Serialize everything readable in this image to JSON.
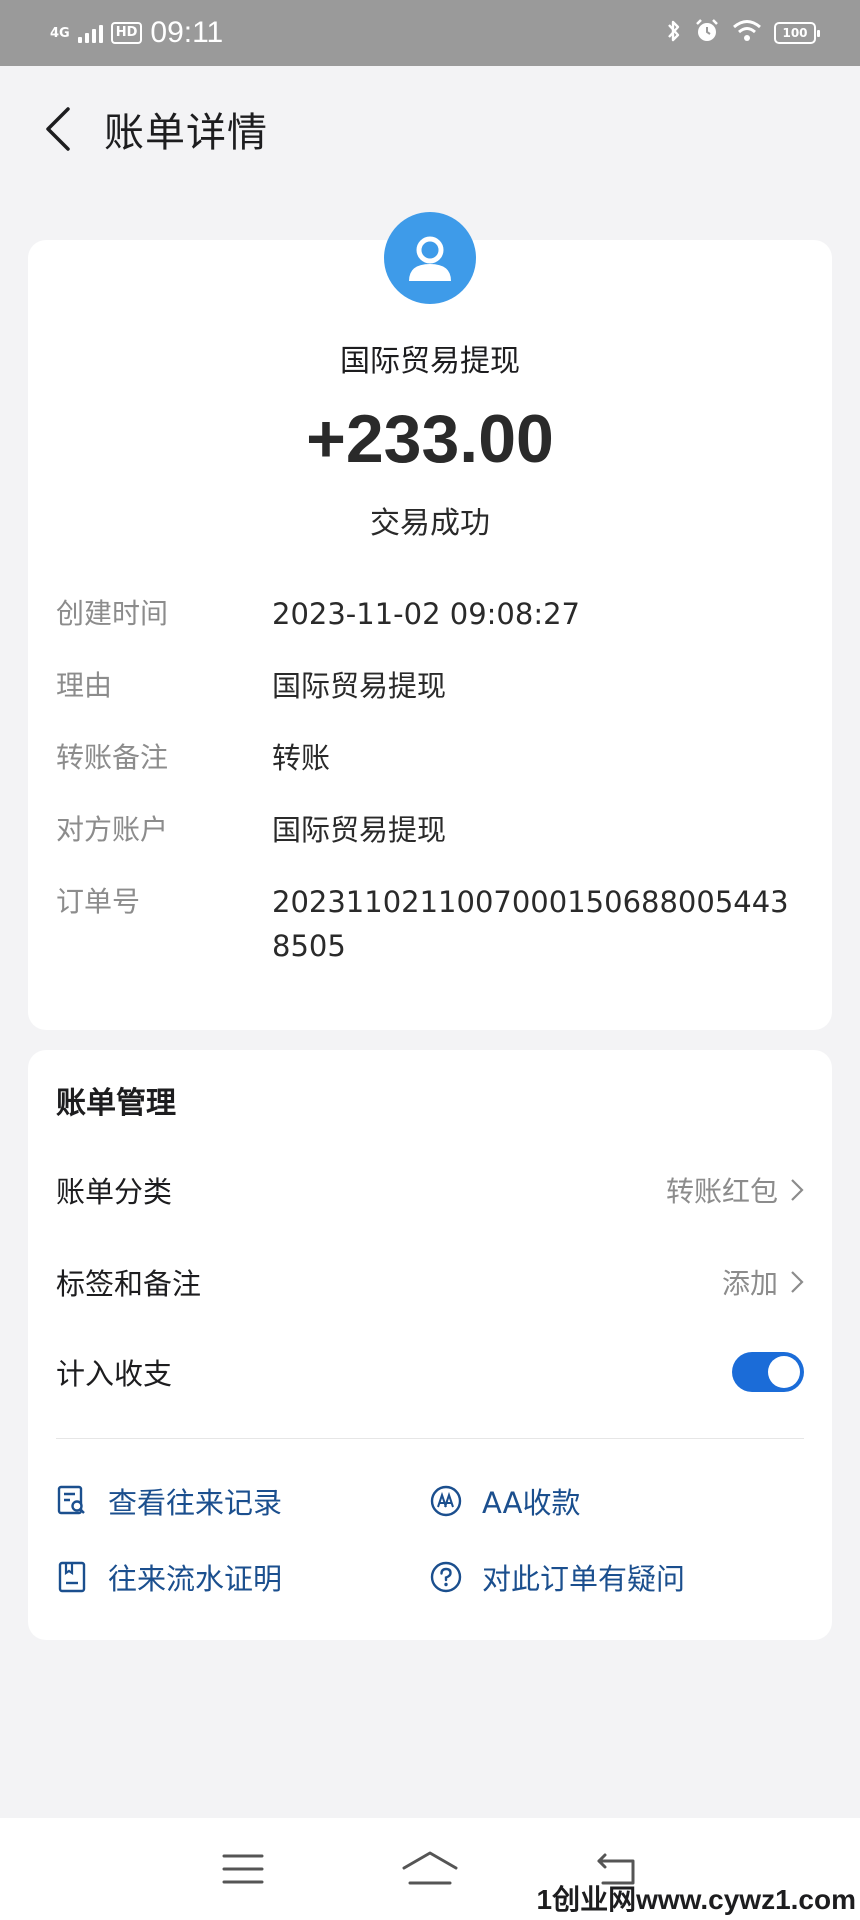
{
  "status_bar": {
    "signal": "4G",
    "hd": "HD",
    "time": "09:11",
    "battery": "100"
  },
  "header": {
    "title": "账单详情"
  },
  "transaction": {
    "merchant": "国际贸易提现",
    "amount": "+233.00",
    "status": "交易成功",
    "details": [
      {
        "label": "创建时间",
        "value": "2023-11-02 09:08:27"
      },
      {
        "label": "理由",
        "value": "国际贸易提现"
      },
      {
        "label": "转账备注",
        "value": "转账"
      },
      {
        "label": "对方账户",
        "value": "国际贸易提现"
      },
      {
        "label": "订单号",
        "value": "20231102110070001506880054438505"
      }
    ]
  },
  "manage": {
    "title": "账单管理",
    "category_label": "账单分类",
    "category_value": "转账红包",
    "tags_label": "标签和备注",
    "tags_value": "添加",
    "count_label": "计入收支",
    "count_enabled": true,
    "actions": [
      {
        "label": "查看往来记录",
        "icon": "record-search-icon"
      },
      {
        "label": "AA收款",
        "icon": "aa-icon"
      },
      {
        "label": "往来流水证明",
        "icon": "certificate-icon"
      },
      {
        "label": "对此订单有疑问",
        "icon": "question-icon"
      }
    ]
  },
  "colors": {
    "accent": "#1b6cd8",
    "avatar": "#3e9be9",
    "link": "#1b4f8e",
    "muted": "#8c8c8c"
  },
  "watermark": "1创业网www.cywz1.com"
}
